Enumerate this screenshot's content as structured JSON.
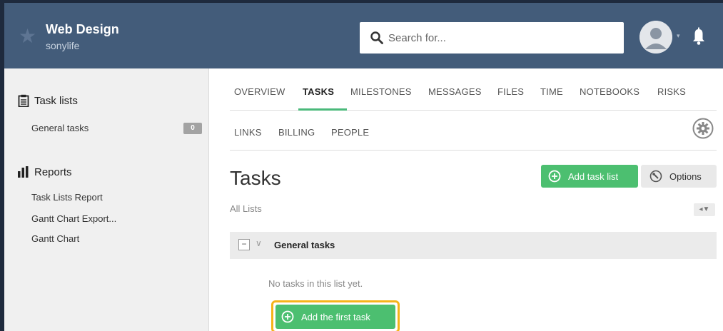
{
  "header": {
    "project_title": "Web Design",
    "project_subtitle": "sonylife",
    "search_placeholder": "Search for...",
    "icons": [
      "star-icon",
      "search-icon",
      "avatar-icon",
      "caret-icon",
      "bell-icon"
    ]
  },
  "sidebar": {
    "task_lists_heading": "Task lists",
    "task_lists": [
      {
        "label": "General tasks",
        "count": "0"
      }
    ],
    "reports_heading": "Reports",
    "reports": [
      {
        "label": "Task Lists Report"
      },
      {
        "label": "Gantt Chart Export..."
      },
      {
        "label": "Gantt Chart"
      }
    ]
  },
  "tabs": {
    "row1": [
      "OVERVIEW",
      "TASKS",
      "MILESTONES",
      "MESSAGES",
      "FILES",
      "TIME",
      "NOTEBOOKS",
      "RISKS"
    ],
    "row2": [
      "LINKS",
      "BILLING",
      "PEOPLE"
    ],
    "active": "TASKS"
  },
  "main": {
    "title": "Tasks",
    "add_task_list_label": "Add task list",
    "options_label": "Options",
    "filter_label": "All Lists",
    "list_name": "General tasks",
    "empty_message": "No tasks in this list yet.",
    "add_first_task_label": "Add the first task"
  },
  "colors": {
    "header_bg": "#435c7a",
    "accent_green": "#4cbf70",
    "highlight": "#f5b41a",
    "active_tab": "#4ab97a"
  }
}
